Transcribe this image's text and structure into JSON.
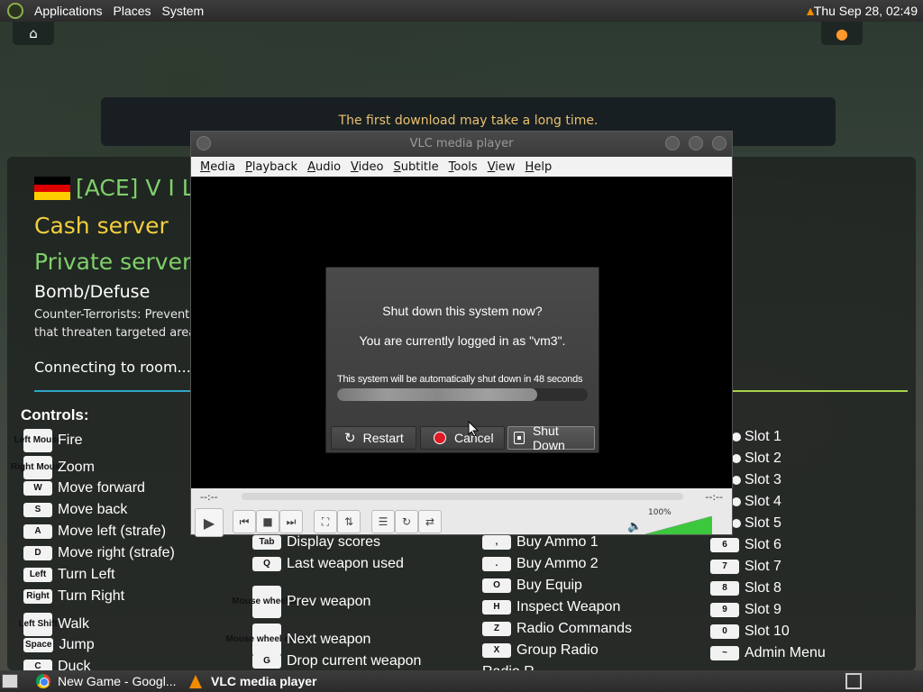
{
  "top_panel": {
    "menus": [
      "Applications",
      "Places",
      "System"
    ],
    "clock": "Thu Sep 28, 02:49"
  },
  "game": {
    "banner": "The first download may take a long time.",
    "server_name": "[ACE] V I L",
    "server_type_1": "Cash server",
    "server_type_2": "Private server",
    "mode": "Bomb/Defuse",
    "mode_desc_line1": "Counter-Terrorists: Prevent",
    "mode_desc_line2": "that threaten targeted area",
    "connecting": "Connecting to room...",
    "controls_title": "Controls:",
    "flag_colors": [
      "#000000",
      "#dd0000",
      "#ffce00"
    ],
    "controls_col1": [
      {
        "key": "Left Mouse",
        "action": "Fire"
      },
      {
        "key": "Right Mouse",
        "action": "Zoom"
      },
      {
        "key": "W",
        "action": "Move forward"
      },
      {
        "key": "S",
        "action": "Move back"
      },
      {
        "key": "A",
        "action": "Move left (strafe)"
      },
      {
        "key": "D",
        "action": "Move right (strafe)"
      },
      {
        "key": "Left",
        "action": "Turn Left"
      },
      {
        "key": "Right",
        "action": "Turn Right"
      },
      {
        "key": "Left Shift",
        "action": "Walk"
      },
      {
        "key": "Space",
        "action": "Jump"
      },
      {
        "key": "C",
        "action": "Duck"
      }
    ],
    "controls_col2": [
      {
        "key": "Tab",
        "action": "Display scores"
      },
      {
        "key": "Q",
        "action": "Last weapon used"
      },
      {
        "key": "Mouse wheel up",
        "action": "Prev weapon"
      },
      {
        "key": "Mouse wheel down",
        "action": "Next weapon"
      },
      {
        "key": "G",
        "action": "Drop current weapon"
      }
    ],
    "controls_col3": [
      {
        "key": ",",
        "action": "Buy Ammo 1"
      },
      {
        "key": ".",
        "action": "Buy Ammo 2"
      },
      {
        "key": "O",
        "action": "Buy Equip"
      },
      {
        "key": "H",
        "action": "Inspect Weapon"
      },
      {
        "key": "Z",
        "action": "Radio Commands"
      },
      {
        "key": "X",
        "action": "Group Radio"
      },
      {
        "key": "",
        "action": "Radio R..."
      }
    ],
    "controls_col4": [
      {
        "key": "",
        "action": "Slot 1"
      },
      {
        "key": "",
        "action": "Slot 2"
      },
      {
        "key": "",
        "action": "Slot 3"
      },
      {
        "key": "",
        "action": "Slot 4"
      },
      {
        "key": "",
        "action": "Slot 5"
      },
      {
        "key": "6",
        "action": "Slot 6"
      },
      {
        "key": "7",
        "action": "Slot 7"
      },
      {
        "key": "8",
        "action": "Slot 8"
      },
      {
        "key": "9",
        "action": "Slot 9"
      },
      {
        "key": "0",
        "action": "Slot 10"
      },
      {
        "key": "~",
        "action": "Admin Menu"
      }
    ]
  },
  "vlc": {
    "title": "VLC media player",
    "menus": [
      "Media",
      "Playback",
      "Audio",
      "Video",
      "Subtitle",
      "Tools",
      "View",
      "Help"
    ],
    "time_elapsed": "--:--",
    "time_total": "--:--",
    "volume_label": "100%",
    "volume_level": 1.0,
    "volume_color": "#3cc83c"
  },
  "dialog": {
    "question": "Shut down this system now?",
    "user_line": "You are currently logged in as \"vm3\".",
    "countdown": "This system will be automatically shut down in 48 seconds",
    "progress": 0.8,
    "restart_label": "Restart",
    "cancel_label": "Cancel",
    "shutdown_label": "Shut Down"
  },
  "taskbar": {
    "tasks": [
      {
        "label": "New Game - Googl...",
        "icon": "chrome-icon"
      },
      {
        "label": "VLC media player",
        "icon": "vlc-cone-icon"
      }
    ]
  }
}
